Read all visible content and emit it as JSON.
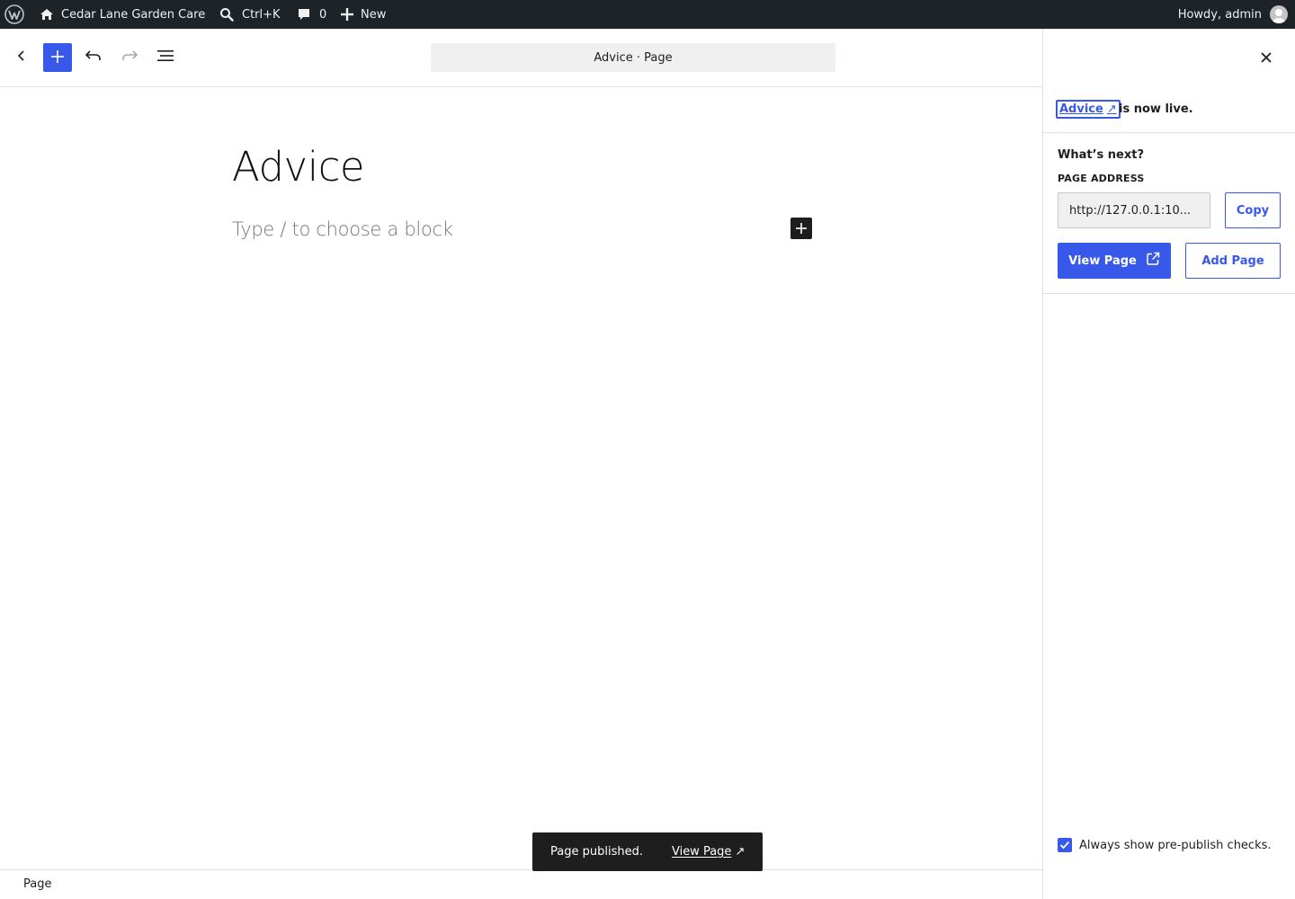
{
  "admin_bar": {
    "site_name": "Cedar Lane Garden Care",
    "search_shortcut": "Ctrl+K",
    "comments_count": "0",
    "new_label": "New",
    "howdy": "Howdy, admin"
  },
  "header": {
    "document_title": "Advice · Page"
  },
  "canvas": {
    "title": "Advice",
    "placeholder": "Type / to choose a block"
  },
  "footer": {
    "breadcrumb": "Page"
  },
  "snackbar": {
    "message": "Page published.",
    "link_label": "View Page",
    "link_arrow": "↗"
  },
  "sidebar": {
    "live_link": "Advice",
    "live_arrow": "↗",
    "live_text": "is now live.",
    "whats_next": "What’s next?",
    "address_label": "PAGE ADDRESS",
    "address_value": "http://127.0.0.1:10...",
    "copy_label": "Copy",
    "view_page_label": "View Page",
    "add_page_label": "Add Page",
    "prepublish_label": "Always show pre-publish checks.",
    "prepublish_checked": true
  },
  "colors": {
    "accent": "#3858e9",
    "admin_bar": "#1d2327",
    "snackbar": "#1e1e1e"
  }
}
